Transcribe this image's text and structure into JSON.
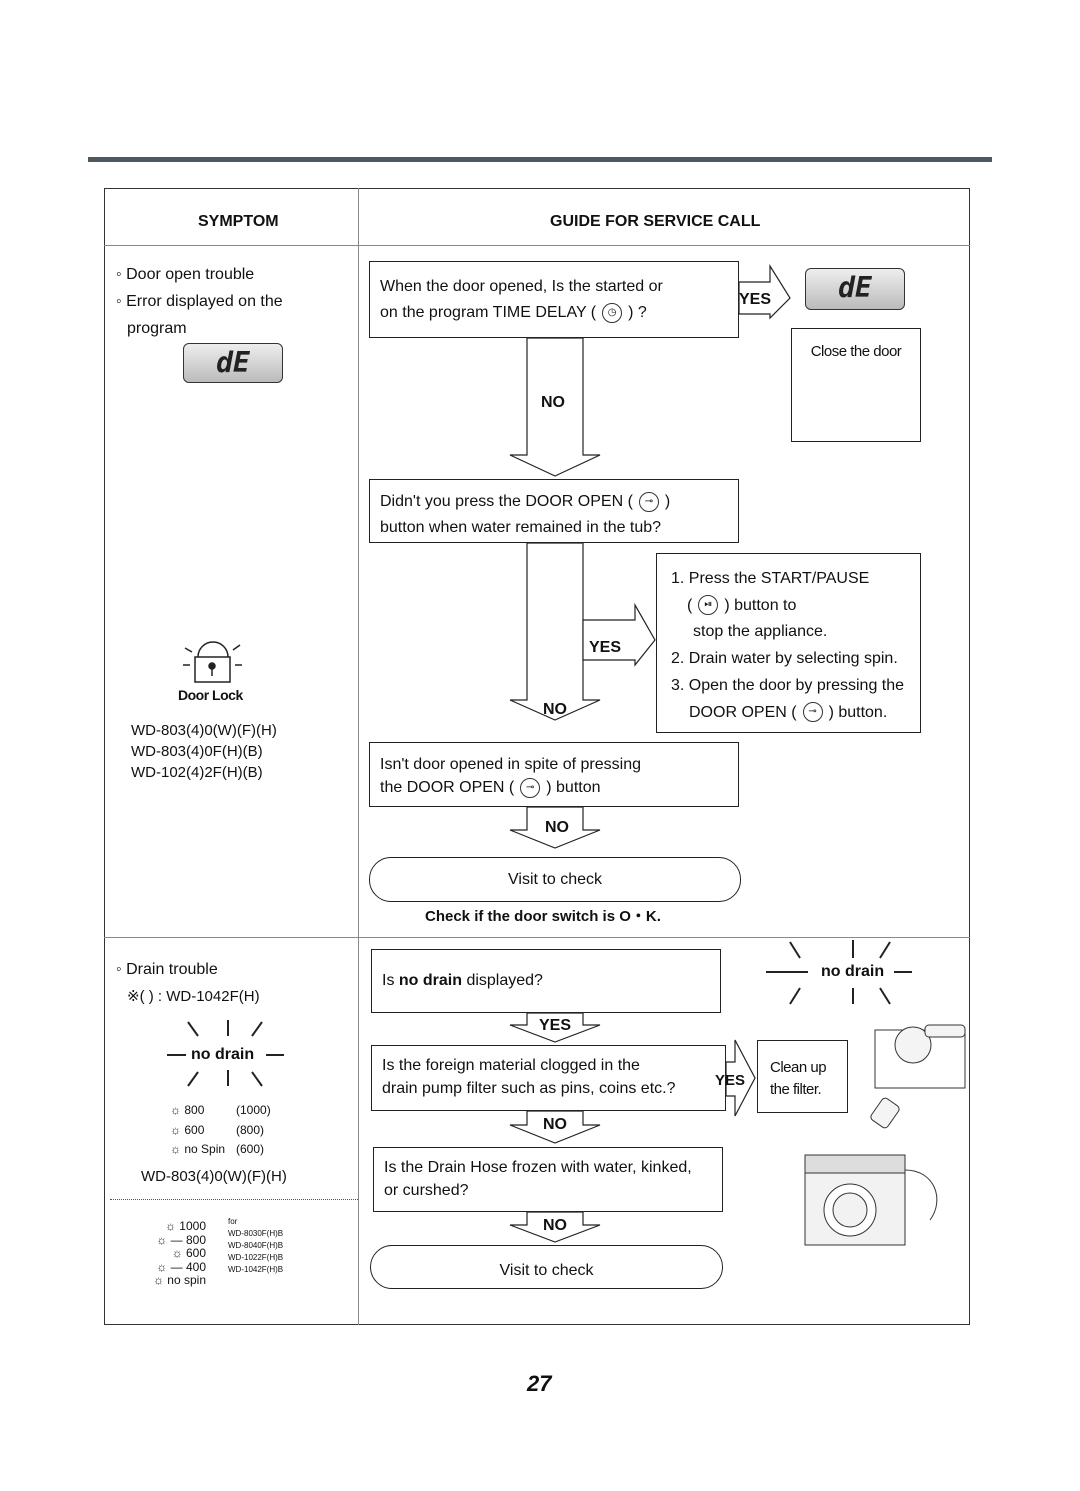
{
  "header": {
    "symptom": "SYMPTOM",
    "guide": "GUIDE FOR SERVICE CALL"
  },
  "colors": {
    "rule": "#4b5a60"
  },
  "section1": {
    "symptom_lines": [
      "◦ Door open trouble",
      "◦ Error displayed on the",
      "program"
    ],
    "display": "dE",
    "door_lock_label": "Door Lock",
    "models": [
      "WD-803(4)0(W)(F)(H)",
      "WD-803(4)0F(H)(B)",
      "WD-102(4)2F(H)(B)"
    ],
    "q1": [
      "When the door opened, Is the started or",
      "on the program TIME DELAY (",
      ") ?"
    ],
    "q2": [
      "Didn't you press the DOOR OPEN (",
      ")",
      "button when water remained in the tub?"
    ],
    "steps": [
      "1. Press the  START/PAUSE",
      "(",
      ") button to",
      "stop the appliance.",
      "2. Drain water by selecting spin.",
      "3. Open the door by pressing the",
      "DOOR OPEN (",
      ")  button."
    ],
    "q3": [
      "Isn't door opened in spite of pressing",
      "the DOOR OPEN (",
      ")  button"
    ],
    "close_door": "Close the door",
    "visit": "Visit to check",
    "check": "Check if the door switch is O・K.",
    "yes": "YES",
    "no": "NO"
  },
  "section2": {
    "symptom_lines": [
      "◦ Drain trouble",
      "※(   ) : WD-1042F(H)"
    ],
    "no_drain": "no drain",
    "spin_table": [
      [
        "800",
        "(1000)"
      ],
      [
        "600",
        "(800)"
      ],
      [
        "no Spin",
        "(600)"
      ]
    ],
    "model": "WD-803(4)0(W)(F)(H)",
    "spin2": [
      "1000",
      "— 800",
      "600",
      "— 400",
      "no spin"
    ],
    "for_label": "for",
    "for_models": [
      "WD-8030F(H)B",
      "WD-8040F(H)B",
      "WD-1022F(H)B",
      "WD-1042F(H)B"
    ],
    "q1_pre": "Is ",
    "q1_bold": "no drain",
    "q1_post": " displayed?",
    "q2": [
      "Is the foreign material clogged in the",
      "drain pump filter such as pins, coins etc.?"
    ],
    "clean": [
      "Clean up",
      "the filter."
    ],
    "q3": [
      "Is the Drain Hose frozen with water, kinked,",
      "or curshed?"
    ],
    "visit": "Visit to check",
    "yes": "YES",
    "no": "NO"
  },
  "page_number": "27"
}
